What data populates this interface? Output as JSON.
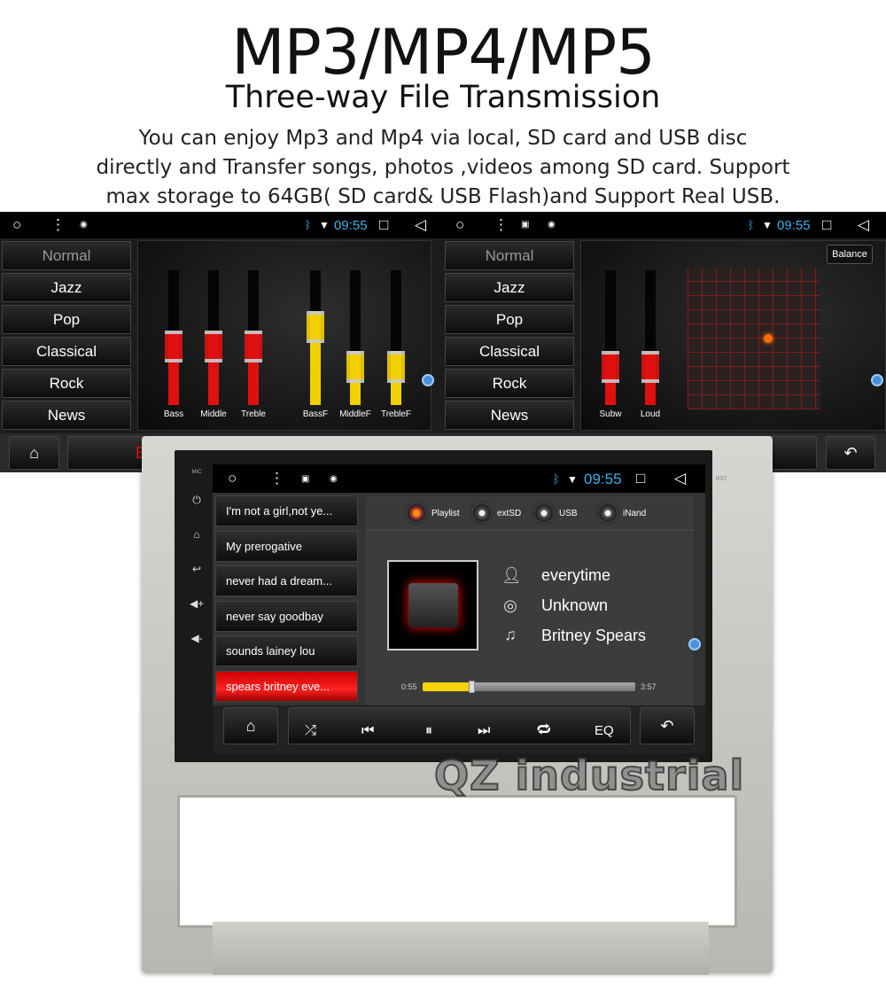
{
  "header": {
    "title": "MP3/MP4/MP5",
    "subtitle": "Three-way File Transmission",
    "description": [
      "You can enjoy Mp3 and Mp4 via local, SD card and USB disc",
      "directly and Transfer songs, photos ,videos among SD card. Support",
      "max storage to 64GB( SD card& USB Flash)and Support Real USB."
    ]
  },
  "status": {
    "time": "09:55"
  },
  "eq_left": {
    "presets": [
      "Normal",
      "Jazz",
      "Pop",
      "Classical",
      "Rock",
      "News"
    ],
    "sliders": [
      {
        "label": "Bass",
        "level": 0.55,
        "color": "#e01010"
      },
      {
        "label": "Middle",
        "level": 0.55,
        "color": "#e01010"
      },
      {
        "label": "Treble",
        "level": 0.55,
        "color": "#e01010"
      },
      {
        "label": "BassF",
        "level": 0.7,
        "color": "#f2d000"
      },
      {
        "label": "MiddleF",
        "level": 0.4,
        "color": "#f2d000"
      },
      {
        "label": "TrebleF",
        "level": 0.4,
        "color": "#f2d000"
      }
    ],
    "partial_label": "E"
  },
  "eq_right": {
    "presets": [
      "Normal",
      "Jazz",
      "Pop",
      "Classical",
      "Rock",
      "News"
    ],
    "balance_label": "Balance",
    "sliders": [
      {
        "label": "Subw",
        "level": 0.4,
        "color": "#e01010"
      },
      {
        "label": "Loud",
        "level": 0.4,
        "color": "#e01010"
      }
    ]
  },
  "player": {
    "playlist": [
      "I'm not a girl,not ye...",
      "My prerogative",
      "never had a dream...",
      "never say goodbay",
      "sounds lainey lou",
      "spears britney eve..."
    ],
    "active_index": 5,
    "sources": [
      "Playlist",
      "extSD",
      "USB",
      "iNand"
    ],
    "song": "everytime",
    "album": "Unknown",
    "artist": "Britney Spears",
    "elapsed": "0:55",
    "total": "3:57",
    "progress": 0.23,
    "eq_label": "EQ"
  },
  "unit": {
    "mic_label": "MIC",
    "rst_label": "RST"
  },
  "watermark": "QZ industrial"
}
